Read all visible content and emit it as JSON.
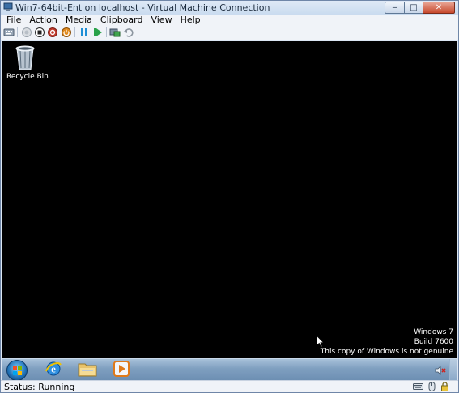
{
  "window": {
    "title": "Win7-64bit-Ent on localhost - Virtual Machine Connection",
    "controls": {
      "minimize": "‒",
      "maximize": "□",
      "close": "✕"
    }
  },
  "menu": {
    "items": [
      "File",
      "Action",
      "Media",
      "Clipboard",
      "View",
      "Help"
    ]
  },
  "toolbar": {
    "buttons": [
      {
        "name": "ctrl-alt-del-icon"
      },
      {
        "name": "start-icon"
      },
      {
        "name": "turn-off-icon"
      },
      {
        "name": "shutdown-icon"
      },
      {
        "name": "save-icon"
      },
      {
        "name": "pause-icon"
      },
      {
        "name": "reset-icon"
      },
      {
        "name": "snapshot-icon"
      },
      {
        "name": "revert-icon"
      }
    ]
  },
  "desktop": {
    "icons": [
      {
        "label": "Recycle Bin",
        "icon": "recycle-bin-icon"
      }
    ],
    "watermark": {
      "line1": "Windows 7",
      "line2": "Build 7600",
      "line3": "This copy of Windows is not genuine"
    }
  },
  "taskbar": {
    "items": [
      {
        "name": "internet-explorer-icon"
      },
      {
        "name": "windows-explorer-icon"
      },
      {
        "name": "media-player-icon"
      }
    ],
    "tray": {
      "name": "volume-muted-icon"
    }
  },
  "status": {
    "text": "Status: Running"
  },
  "colors": {
    "desktop": "#000000",
    "chrome": "#dce7f4",
    "taskbar": "#7f9fc0",
    "close_button": "#c7482d"
  }
}
